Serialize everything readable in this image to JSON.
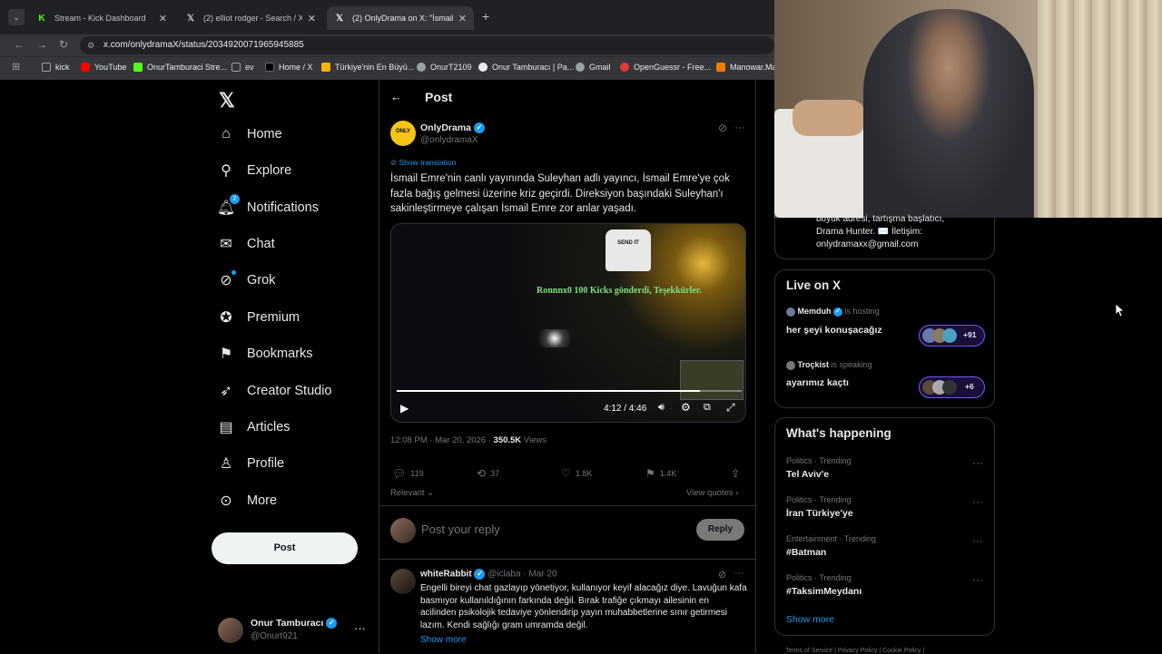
{
  "browser": {
    "tabs": [
      {
        "title": "Stream - Kick Dashboard",
        "icon": "kick-icon",
        "active": false
      },
      {
        "title": "(2) elliot rodger - Search / X",
        "icon": "x-logo-icon",
        "active": false
      },
      {
        "title": "(2) OnlyDrama on X: \"İsmail Em",
        "icon": "x-logo-icon",
        "active": true
      }
    ],
    "new_tab": "+",
    "url": "x.com/onlydramaX/status/2034920071965945885",
    "bookmarks": [
      "kick",
      "YouTube",
      "OnurTamburaci Stre...",
      "ev",
      "Home / X",
      "Türkiye'nin En Büyü...",
      "OnurT2109",
      "Onur Tamburacı | Pa...",
      "Gmail",
      "OpenGuessr - Free...",
      "Manowar.Mar"
    ]
  },
  "nav": {
    "items": [
      {
        "label": "Home",
        "icon": "home-icon"
      },
      {
        "label": "Explore",
        "icon": "search-icon"
      },
      {
        "label": "Notifications",
        "icon": "bell-icon",
        "badge": "2"
      },
      {
        "label": "Chat",
        "icon": "mail-icon"
      },
      {
        "label": "Grok",
        "icon": "grok-icon"
      },
      {
        "label": "Premium",
        "icon": "premium-icon"
      },
      {
        "label": "Bookmarks",
        "icon": "bookmark-icon"
      },
      {
        "label": "Creator Studio",
        "icon": "rocket-icon"
      },
      {
        "label": "Articles",
        "icon": "articles-icon"
      },
      {
        "label": "Profile",
        "icon": "person-icon"
      },
      {
        "label": "More",
        "icon": "more-circle-icon"
      }
    ],
    "post_button": "Post",
    "account": {
      "name": "Onur Tamburacı",
      "handle": "@Onurt921"
    }
  },
  "post": {
    "header": "Post",
    "author": {
      "name": "OnlyDrama",
      "handle": "@onlydramaX"
    },
    "show_translation": "Show translation",
    "text": "İsmail Emre'nin canlı yayınında Suleyhan adlı yayıncı, İsmail Emre'ye çok fazla bağış gelmesi üzerine kriz geçirdi. Direksiyon başındaki Suleyhan'ı sakinleştirmeye çalışan İsmail Emre zor anlar yaşadı.",
    "video": {
      "overlay_text": "Ronnnx0 100 Kicks gönderdi, Teşekkürler.",
      "shirt_text": "SEND IT",
      "time": "4:12 / 4:46",
      "progress": 0.88
    },
    "timestamp": "12:08 PM · Mar 20, 2026 · ",
    "views_count": "350.5K",
    "views_label": " Views",
    "stats": {
      "replies": "119",
      "reposts": "37",
      "likes": "1.8K",
      "bookmarks": "1.4K"
    },
    "sort_label": "Relevant",
    "view_quotes": "View quotes",
    "reply_placeholder": "Post your reply",
    "reply_button": "Reply"
  },
  "reply": {
    "name": "whiteRabbit",
    "handle": "@iclaba · Mar 20",
    "text": "Engelli bireyi chat gazlayıp yönetiyor, kullanıyor keyif alacağız diye. Lavuğun kafa basmıyor kullanıldığının farkında değil. Bırak trafiğe çıkmayı ailesinin en acilinden psikolojik tedaviye yönlendirip yayın muhabbetlerine sınır getirmesi lazım. Kendi sağlığı gram umramda değil.",
    "show_more": "Show more"
  },
  "sidebar": {
    "bio_fragment": "büyük adresi, tartışma başlatıcı,\nDrama Hunter. ✉️ İletişim:\nonlydramaxx@gmail.com",
    "live": {
      "title": "Live on X",
      "items": [
        {
          "host": "Memduh",
          "status": "is hosting",
          "title": "her şeyi konuşacağız",
          "count": "+91"
        },
        {
          "host": "Troçkist",
          "status": "is speaking",
          "title": "ayarımız kaçtı",
          "count": "+6"
        }
      ]
    },
    "happening": {
      "title": "What's happening",
      "trends": [
        {
          "category": "Politics · Trending",
          "name": "Tel Aviv'e"
        },
        {
          "category": "Politics · Trending",
          "name": "İran Türkiye'ye"
        },
        {
          "category": "Entertainment · Trending",
          "name": "#Batman"
        },
        {
          "category": "Politics · Trending",
          "name": "#TaksimMeydanı"
        }
      ],
      "show_more": "Show more"
    },
    "footer": "Terms of Service  |  Privacy Policy  |  Cookie Policy  |"
  }
}
